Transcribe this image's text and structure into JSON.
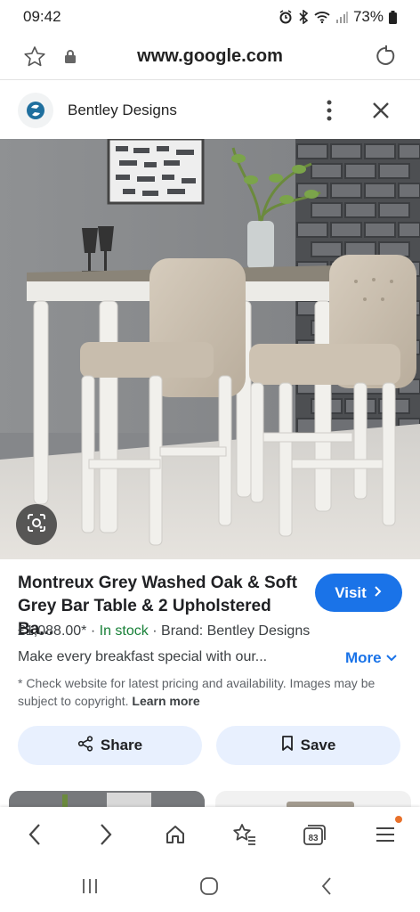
{
  "status_bar": {
    "time": "09:42",
    "battery": "73%"
  },
  "browser": {
    "url": "www.google.com"
  },
  "site": {
    "name": "Bentley Designs"
  },
  "product": {
    "title": "Montreux Grey Washed Oak & Soft Grey Bar Table & 2 Upholstered Ba...",
    "price": "£1,088.00*",
    "separator": "·",
    "stock": "In stock",
    "brand": "Brand: Bentley Designs",
    "description": "Make every breakfast special with our...",
    "more_label": "More",
    "visit_label": "Visit",
    "disclaimer": "* Check website for latest pricing and availability. Images may be subject to copyright.",
    "learn_more": "Learn more"
  },
  "actions": {
    "share_label": "Share",
    "save_label": "Save"
  },
  "bottom_nav": {
    "tabs_count": "83"
  },
  "colors": {
    "accent": "#1a73e8",
    "stock_green": "#188038",
    "chip_bg": "#e8f0fe",
    "notification_dot": "#e8712b"
  },
  "icons": [
    "alarm-icon",
    "bluetooth-icon",
    "wifi-icon",
    "signal-icon",
    "battery-icon",
    "star-icon",
    "lock-icon",
    "reload-icon",
    "kebab-menu-icon",
    "close-icon",
    "lens-icon",
    "chevron-right-icon",
    "chevron-down-icon",
    "share-icon",
    "bookmark-icon",
    "back-icon",
    "forward-icon",
    "home-icon",
    "bookmarks-icon",
    "tabs-icon",
    "menu-icon",
    "recents-icon",
    "home-circle-icon",
    "system-back-icon"
  ]
}
